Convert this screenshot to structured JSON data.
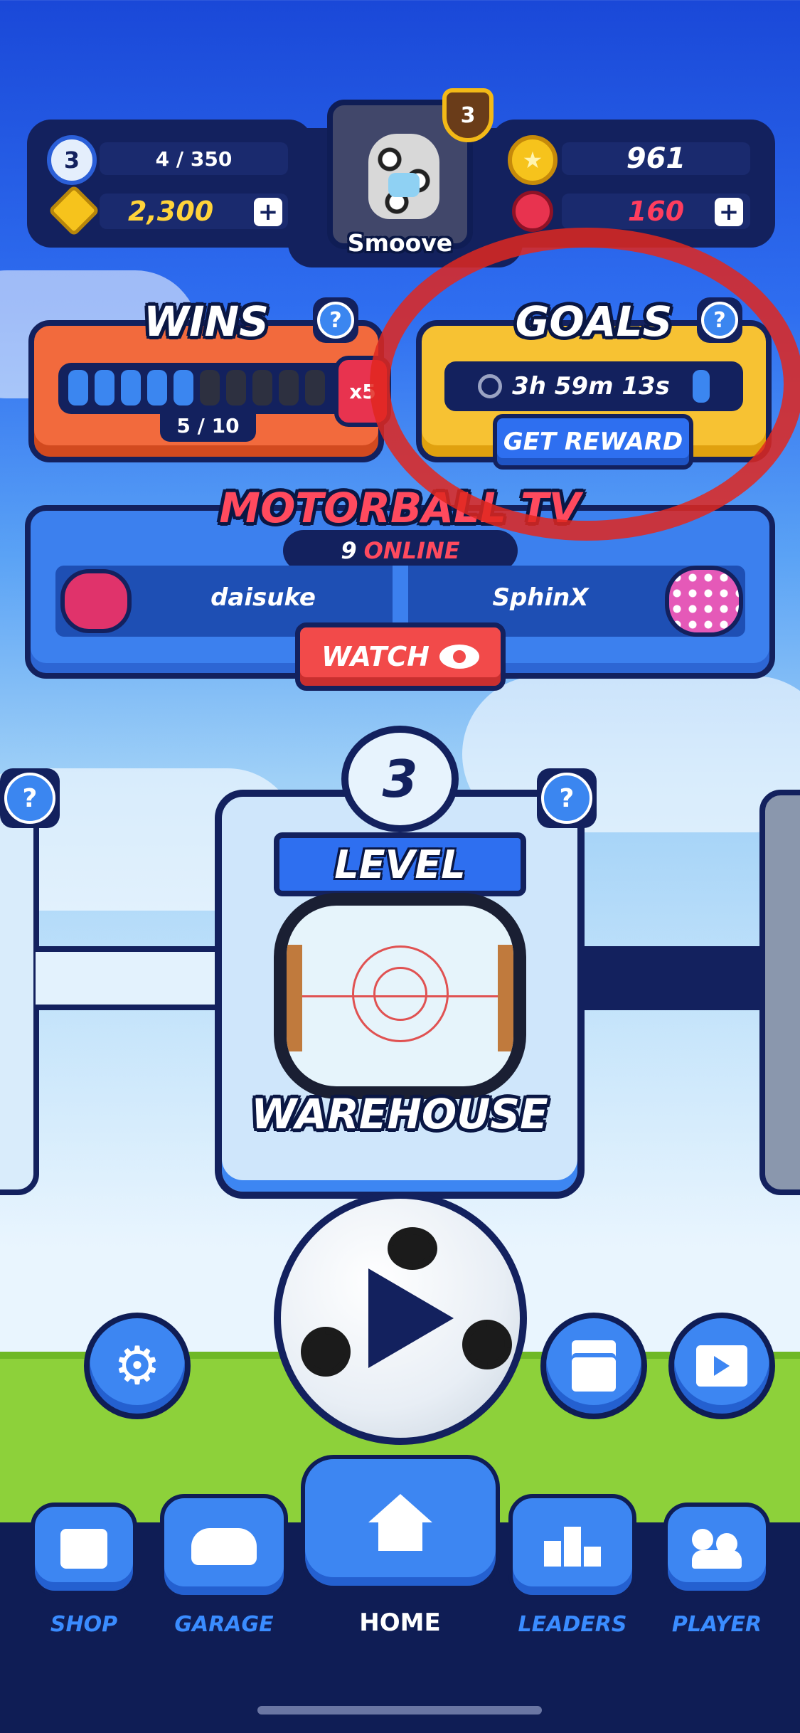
{
  "player": {
    "level": "3",
    "xp": "4 / 350",
    "gems": "2,300",
    "name": "Smoove",
    "rank": "3"
  },
  "currency": {
    "coins": "961",
    "tokens": "160"
  },
  "wins": {
    "title": "WINS",
    "progress": "5 / 10",
    "filled": 5,
    "total": 10,
    "multiplier": "x5"
  },
  "goals": {
    "title": "GOALS",
    "timer": "3h 59m 13s",
    "button": "GET REWARD"
  },
  "tv": {
    "title": "MOTORBALL TV",
    "online_count": "9",
    "online_label": "ONLINE",
    "player_left": "daisuke",
    "player_right": "SphinX",
    "watch_label": "WATCH"
  },
  "level_card": {
    "number": "3",
    "banner": "LEVEL",
    "arena_name": "WAREHOUSE"
  },
  "nav": {
    "shop": "SHOP",
    "garage": "GARAGE",
    "home": "HOME",
    "leaders": "LEADERS",
    "player": "PLAYER"
  },
  "colors": {
    "wins_panel": "#f26a3d",
    "goals_panel": "#f7c233",
    "annotation_circle": "#e0271f",
    "nav_bg": "#0f1d55"
  },
  "icons": {
    "settings": "gear-icon",
    "news": "newspaper-icon",
    "video": "film-icon",
    "help": "question-icon"
  }
}
